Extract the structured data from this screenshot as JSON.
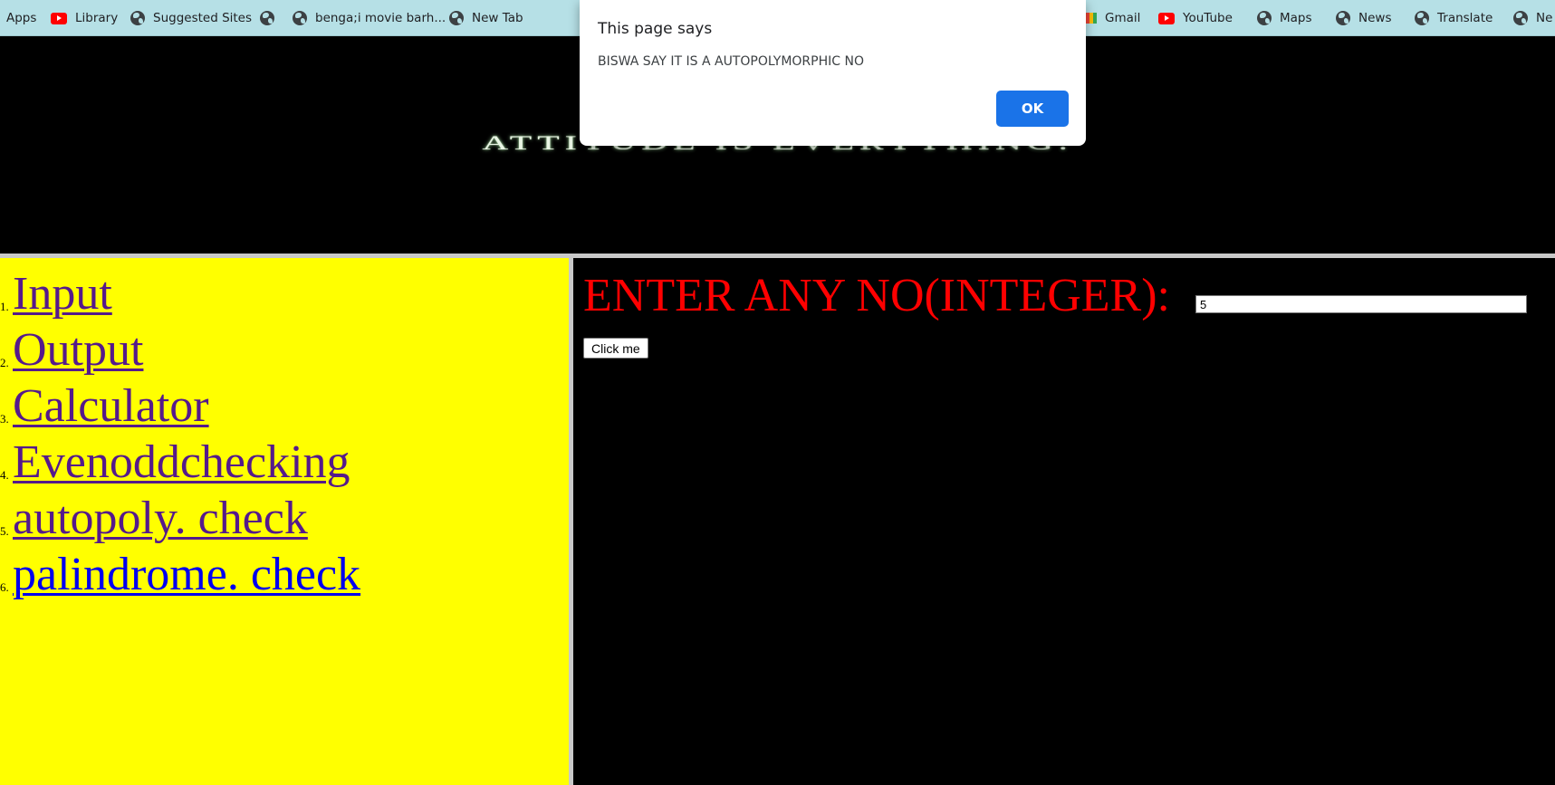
{
  "bookmarks": {
    "items": [
      {
        "label": "Apps",
        "icon": "none"
      },
      {
        "label": "Library",
        "icon": "youtube-icon"
      },
      {
        "label": "Suggested Sites",
        "icon": "globe-icon"
      },
      {
        "label": "",
        "icon": "globe-icon"
      },
      {
        "label": "benga;i movie barh...",
        "icon": "globe-icon"
      },
      {
        "label": "New Tab",
        "icon": "globe-icon"
      },
      {
        "label": "Gmail",
        "icon": "gmail-icon"
      },
      {
        "label": "YouTube",
        "icon": "youtube-icon"
      },
      {
        "label": "Maps",
        "icon": "globe-icon"
      },
      {
        "label": "News",
        "icon": "globe-icon"
      },
      {
        "label": "Translate",
        "icon": "globe-icon"
      },
      {
        "label": "Ne",
        "icon": "globe-icon"
      }
    ]
  },
  "banner": {
    "text": "ATTITUDE IS EVERYTHING."
  },
  "nav": {
    "items": [
      {
        "num": "1.",
        "label": "Input"
      },
      {
        "num": "2.",
        "label": "Output"
      },
      {
        "num": "3.",
        "label": "Calculator"
      },
      {
        "num": "4.",
        "label": "Evenoddchecking"
      },
      {
        "num": "5.",
        "label": "autopoly. check"
      },
      {
        "num": "6.",
        "label": "palindrome. check"
      }
    ]
  },
  "main": {
    "prompt": "ENTER ANY NO(INTEGER):",
    "input_value": "5",
    "button_label": "Click me"
  },
  "dialog": {
    "title": "This page says",
    "message": "BISWA SAY IT IS A AUTOPOLYMORPHIC NO",
    "ok_label": "OK"
  },
  "colors": {
    "nav_bg": "#ffff00",
    "link_visited": "#551a8b",
    "link_unvisited": "#0000ee",
    "prompt": "#ff0000",
    "ok_button": "#1a73e8",
    "bookmarks_bg": "#b6e0e6"
  }
}
